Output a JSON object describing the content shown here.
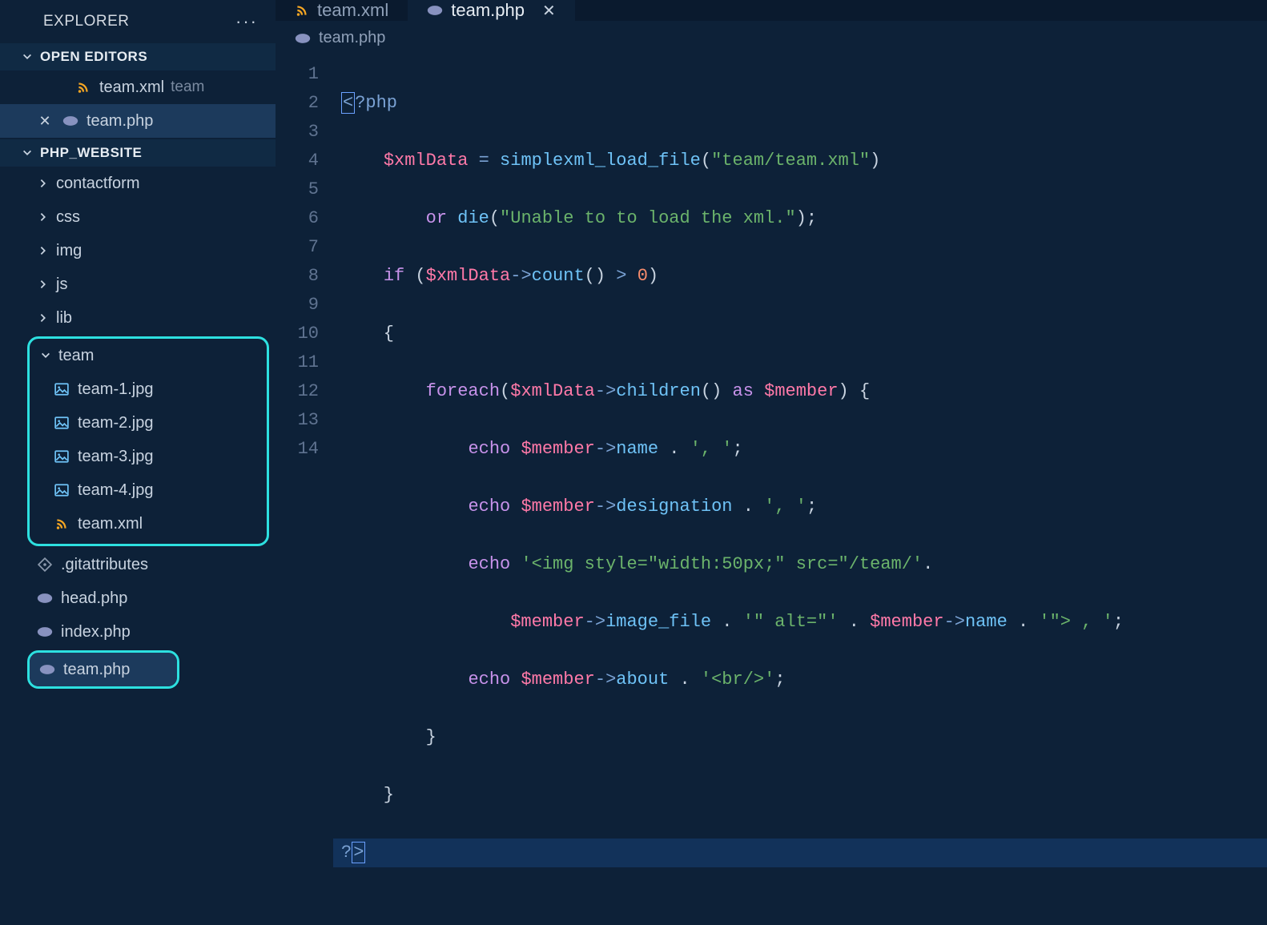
{
  "explorer": {
    "title": "EXPLORER",
    "openEditorsLabel": "OPEN EDITORS",
    "projectLabel": "PHP_WEBSITE",
    "openEditors": [
      {
        "name": "team.xml",
        "suffix": "team",
        "icon": "rss",
        "close": false
      },
      {
        "name": "team.php",
        "suffix": "",
        "icon": "php",
        "close": true,
        "active": true
      }
    ],
    "tree": {
      "folders": [
        {
          "name": "contactform"
        },
        {
          "name": "css"
        },
        {
          "name": "img"
        },
        {
          "name": "js"
        },
        {
          "name": "lib"
        }
      ],
      "teamFolder": {
        "name": "team",
        "children": [
          {
            "name": "team-1.jpg",
            "icon": "img"
          },
          {
            "name": "team-2.jpg",
            "icon": "img"
          },
          {
            "name": "team-3.jpg",
            "icon": "img"
          },
          {
            "name": "team-4.jpg",
            "icon": "img"
          },
          {
            "name": "team.xml",
            "icon": "rss"
          }
        ]
      },
      "rootFiles": [
        {
          "name": ".gitattributes",
          "icon": "git"
        },
        {
          "name": "head.php",
          "icon": "php"
        },
        {
          "name": "index.php",
          "icon": "php"
        }
      ],
      "highlightedFile": {
        "name": "team.php",
        "icon": "php"
      }
    }
  },
  "tabs": [
    {
      "name": "team.xml",
      "icon": "rss",
      "active": false
    },
    {
      "name": "team.php",
      "icon": "php",
      "active": true
    }
  ],
  "breadcrumb": {
    "icon": "php",
    "name": "team.php"
  },
  "code": {
    "lineCount": 14,
    "lines": [
      "<?php",
      "    $xmlData = simplexml_load_file(\"team/team.xml\")",
      "        or die(\"Unable to to load the xml.\");",
      "    if ($xmlData->count() > 0)",
      "    {",
      "        foreach($xmlData->children() as $member) {",
      "            echo $member->name . ', ';",
      "            echo $member->designation . ', ';",
      "            echo '<img style=\"width:50px;\" src=\"/team/'.",
      "                $member->image_file . '\" alt=\"' . $member->name . '\"> , ';",
      "            echo $member->about . '<br/>';",
      "        }",
      "    }",
      "?>"
    ]
  }
}
